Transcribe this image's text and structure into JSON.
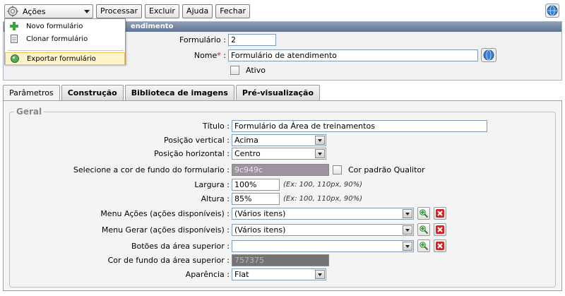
{
  "toolbar": {
    "actions_label": "Ações",
    "process_label": "Processar",
    "delete_label": "Excluir",
    "help_label": "Ajuda",
    "close_label": "Fechar"
  },
  "actions_menu": {
    "items": [
      {
        "label": "Novo formulário",
        "icon": "plus-icon"
      },
      {
        "label": "Clonar formulário",
        "icon": "document-icon"
      },
      {
        "label": "Exportar formulário",
        "icon": "globe-icon"
      }
    ]
  },
  "top_panel": {
    "header_title": "endimento",
    "form_label": "Formulário :",
    "form_value": "2",
    "name_label": "Nome",
    "name_required": "*",
    "name_suffix": " :",
    "name_value": "Formulário de atendimento",
    "active_label": "Ativo"
  },
  "tabs": [
    {
      "label": "Parâmetros",
      "active": true
    },
    {
      "label": "Construção",
      "active": false
    },
    {
      "label": "Biblioteca de imagens",
      "active": false
    },
    {
      "label": "Pré-visualização",
      "active": false
    }
  ],
  "geral": {
    "legend": "Geral",
    "titulo_label": "Título :",
    "titulo_value": "Formulário da Área de treinamentos",
    "pos_vertical_label": "Posição vertical :",
    "pos_vertical_value": "Acima",
    "pos_horizontal_label": "Posição horizontal :",
    "pos_horizontal_value": "Centro",
    "bg_color_label": "Selecione a cor de fundo do formulario :",
    "bg_color_value": "9c949c",
    "bg_color_hex": "#9c949c",
    "default_color_label": "Cor padrão Qualitor",
    "largura_label": "Largura :",
    "largura_value": "100%",
    "largura_hint": "(Ex: 100, 110px, 90%)",
    "altura_label": "Altura :",
    "altura_value": "85%",
    "altura_hint": "(Ex: 100, 110px, 90%)",
    "menu_acoes_label": "Menu Ações (ações disponíveis) :",
    "menu_acoes_value": "(Vários itens)",
    "menu_gerar_label": "Menu Gerar (ações disponíveis) :",
    "menu_gerar_value": "(Vários itens)",
    "botoes_label": "Botões da área superior :",
    "botoes_value": "",
    "cor_superior_label": "Cor de fundo da área superior :",
    "cor_superior_value": "757375",
    "cor_superior_hex": "#757375",
    "aparencia_label": "Aparência :",
    "aparencia_value": "Flat"
  }
}
